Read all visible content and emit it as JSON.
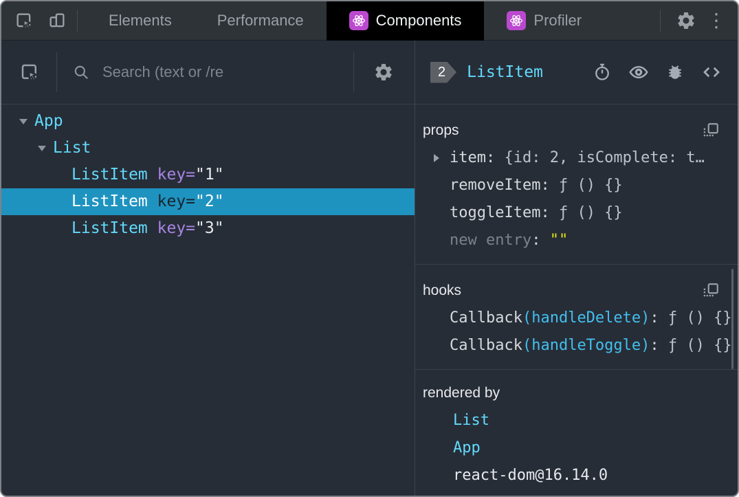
{
  "colors": {
    "accent_cyan": "#61dafb",
    "key_purple": "#a885e3",
    "selected_row_bg": "#1f93c0",
    "react_badge_purple": "#bb49cf",
    "string_yellow": "#e5e510"
  },
  "tabbar": {
    "tabs": [
      {
        "label": "Elements",
        "active": false
      },
      {
        "label": "Performance",
        "active": false
      },
      {
        "label": "Components",
        "active": true
      },
      {
        "label": "Profiler",
        "active": false
      }
    ]
  },
  "left_toolbar": {
    "search_placeholder": "Search (text or /re"
  },
  "tree": {
    "rows": [
      {
        "name": "App",
        "depth": 0,
        "caret": true,
        "selected": false
      },
      {
        "name": "List",
        "depth": 1,
        "caret": true,
        "selected": false
      },
      {
        "name": "ListItem",
        "key": "1",
        "depth": 2,
        "caret": false,
        "selected": false
      },
      {
        "name": "ListItem",
        "key": "2",
        "depth": 2,
        "caret": false,
        "selected": true
      },
      {
        "name": "ListItem",
        "key": "3",
        "depth": 2,
        "caret": false,
        "selected": false
      }
    ]
  },
  "inspector": {
    "badge_count": "2",
    "component_name": "ListItem",
    "props": {
      "title": "props",
      "rows": [
        {
          "name": "item",
          "value": "{id: 2, isComplete: t…",
          "expandable": true,
          "muted": false,
          "value_style": "normal"
        },
        {
          "name": "removeItem",
          "value": "ƒ () {}",
          "expandable": false,
          "muted": false,
          "value_style": "normal"
        },
        {
          "name": "toggleItem",
          "value": "ƒ () {}",
          "expandable": false,
          "muted": false,
          "value_style": "normal"
        },
        {
          "name": "new entry",
          "value": "\"\"",
          "expandable": false,
          "muted": true,
          "value_style": "yellow"
        }
      ]
    },
    "hooks": {
      "title": "hooks",
      "rows": [
        {
          "name": "Callback",
          "arg": "(handleDelete)",
          "value": "ƒ () {}"
        },
        {
          "name": "Callback",
          "arg": "(handleToggle)",
          "value": "ƒ () {}"
        }
      ]
    },
    "rendered_by": {
      "title": "rendered by",
      "items": [
        {
          "label": "List",
          "link": true
        },
        {
          "label": "App",
          "link": true
        },
        {
          "label": "react-dom@16.14.0",
          "link": false
        }
      ]
    }
  }
}
